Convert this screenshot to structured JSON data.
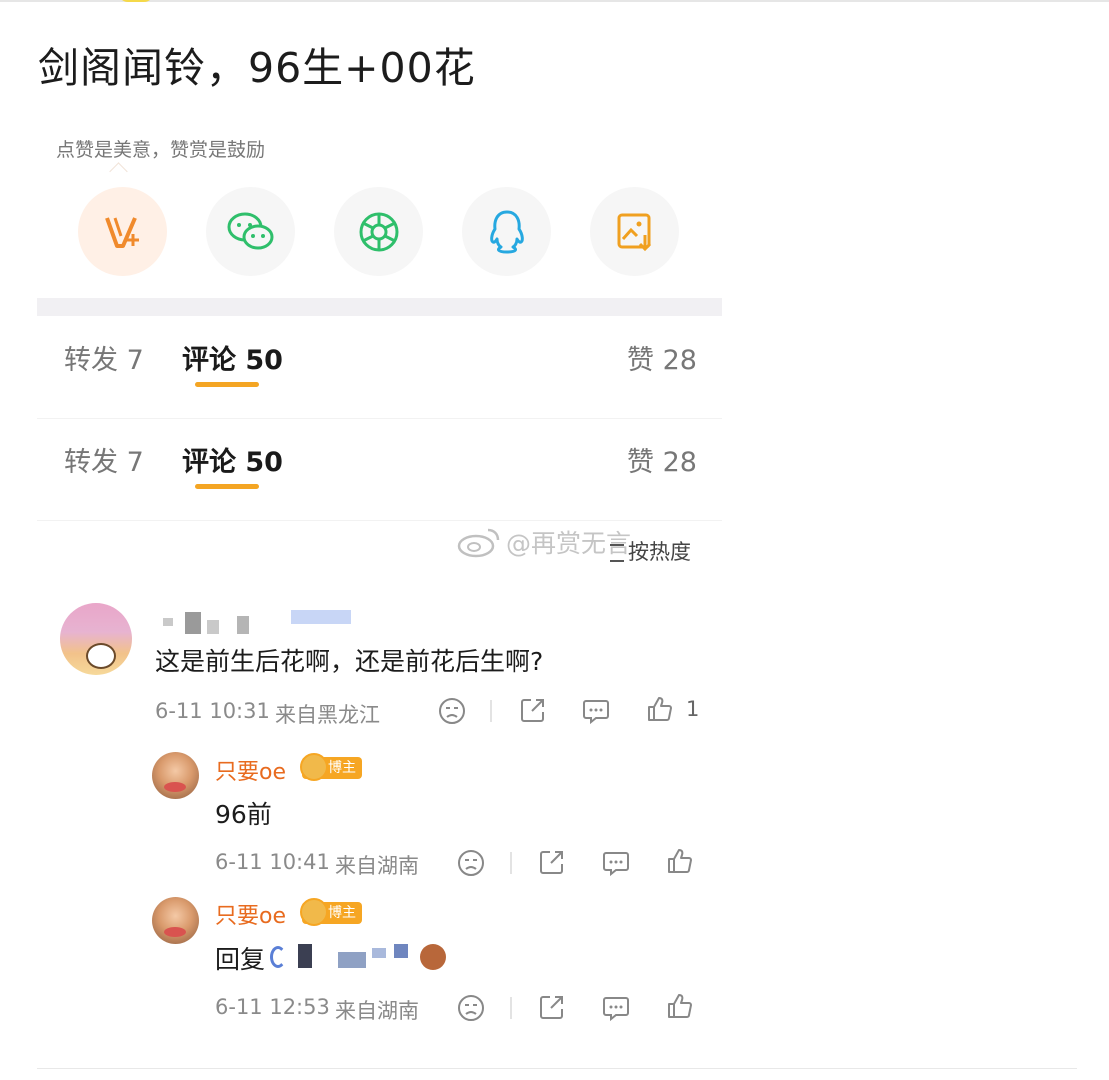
{
  "post": {
    "title": "剑阁闻铃，96生+00花"
  },
  "share": {
    "hint": "点赞是美意，赞赏是鼓励",
    "icons": [
      "reward-icon",
      "wechat-icon",
      "moments-icon",
      "qq-icon",
      "save-image-icon"
    ]
  },
  "tabs_1": {
    "repost": "转发 7",
    "comment": "评论 50",
    "like": "赞 28"
  },
  "tabs_2": {
    "repost": "转发 7",
    "comment": "评论 50",
    "like": "赞 28"
  },
  "watermark": "@再赏无言",
  "sort": "按热度",
  "comment": {
    "text": "这是前生后花啊，还是前花后生啊?",
    "time": "6-11 10:31",
    "location": "来自黑龙江",
    "likes": "1"
  },
  "replies": [
    {
      "name": "只要oe",
      "badge": "博主",
      "text": "96前",
      "time": "6-11 10:41",
      "location": "来自湖南"
    },
    {
      "name": "只要oe",
      "badge": "博主",
      "text": "回复",
      "time": "6-11 12:53",
      "location": "来自湖南"
    }
  ],
  "colors": {
    "accent": "#f4a523",
    "name": "#e86b1f"
  }
}
